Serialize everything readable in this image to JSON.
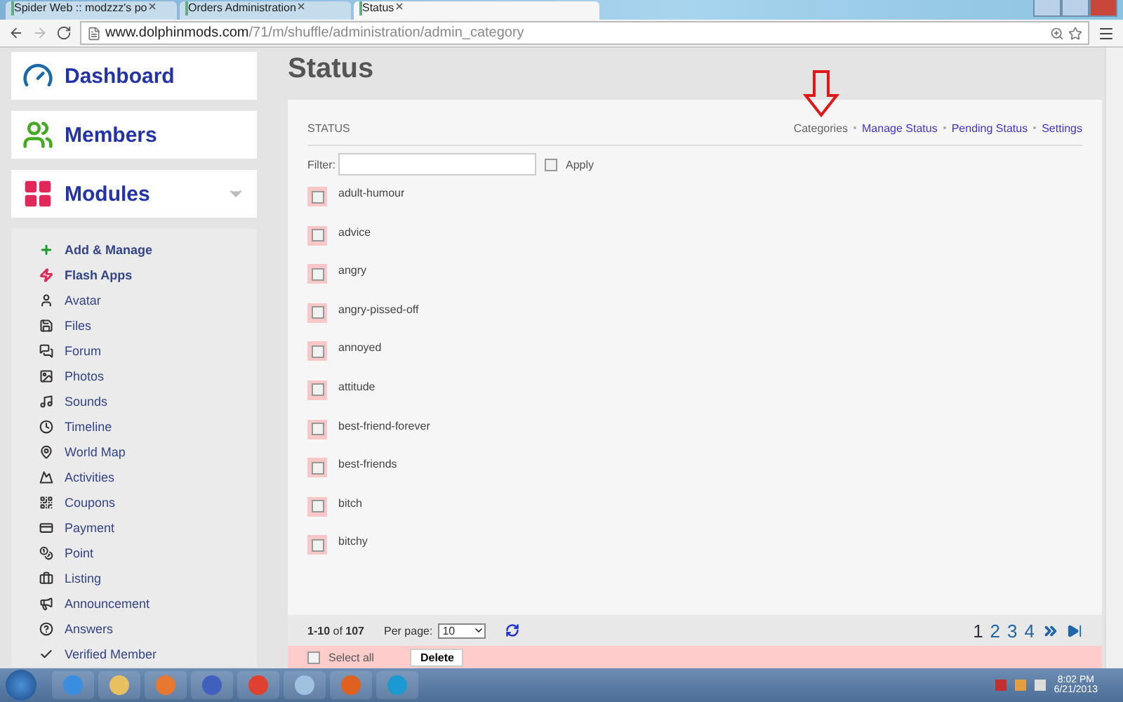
{
  "browser": {
    "tabs": [
      {
        "title": "Spider Web :: modzzz's po",
        "selected": false
      },
      {
        "title": "Orders Administration",
        "selected": false
      },
      {
        "title": "Status",
        "selected": true
      }
    ],
    "url_host": "www.dolphinmods.com",
    "url_path": "/71/m/shuffle/administration/admin_category"
  },
  "sidebar": {
    "cards": [
      {
        "label": "Dashboard",
        "kind": "dashboard"
      },
      {
        "label": "Members",
        "kind": "members"
      },
      {
        "label": "Modules",
        "kind": "modules",
        "expanded": true
      }
    ],
    "items": [
      {
        "label": "Add & Manage",
        "kind": "action"
      },
      {
        "label": "Flash Apps",
        "kind": "action"
      },
      {
        "label": "Avatar",
        "kind": "module"
      },
      {
        "label": "Files",
        "kind": "module"
      },
      {
        "label": "Forum",
        "kind": "module"
      },
      {
        "label": "Photos",
        "kind": "module"
      },
      {
        "label": "Sounds",
        "kind": "module"
      },
      {
        "label": "Timeline",
        "kind": "module"
      },
      {
        "label": "World Map",
        "kind": "module"
      },
      {
        "label": "Activities",
        "kind": "module"
      },
      {
        "label": "Coupons",
        "kind": "module"
      },
      {
        "label": "Payment",
        "kind": "module"
      },
      {
        "label": "Point",
        "kind": "module"
      },
      {
        "label": "Listing",
        "kind": "module"
      },
      {
        "label": "Announcement",
        "kind": "module"
      },
      {
        "label": "Answers",
        "kind": "module"
      },
      {
        "label": "Verified Member",
        "kind": "module"
      }
    ]
  },
  "page": {
    "title": "Status",
    "panel": {
      "title": "STATUS",
      "links": [
        {
          "label": "Categories",
          "selected": true
        },
        {
          "label": "Manage Status",
          "selected": false
        },
        {
          "label": "Pending Status",
          "selected": false
        },
        {
          "label": "Settings",
          "selected": false
        }
      ],
      "filter": {
        "label": "Filter:",
        "apply_label": "Apply",
        "apply_checked": false
      },
      "items": [
        {
          "label": "adult-humour",
          "checked": false
        },
        {
          "label": "advice",
          "checked": false
        },
        {
          "label": "angry",
          "checked": false
        },
        {
          "label": "angry-pissed-off",
          "checked": false
        },
        {
          "label": "annoyed",
          "checked": false
        },
        {
          "label": "attitude",
          "checked": false
        },
        {
          "label": "best-friend-forever",
          "checked": false
        },
        {
          "label": "best-friends",
          "checked": false
        },
        {
          "label": "bitch",
          "checked": false
        },
        {
          "label": "bitchy",
          "checked": false
        }
      ],
      "pagination": {
        "summary": "**1-10** of **107**",
        "per_page_label": "Per page:",
        "per_page": "10",
        "pages": [
          {
            "label": "1",
            "selected": true
          },
          {
            "label": "2",
            "selected": false
          },
          {
            "label": "3",
            "selected": false
          },
          {
            "label": "4",
            "selected": false
          }
        ]
      },
      "actions": {
        "select_all": "Select all",
        "select_all_checked": false,
        "delete": "Delete"
      }
    }
  },
  "taskbar": {
    "time": "8:02 PM",
    "date": "6/21/2013"
  }
}
